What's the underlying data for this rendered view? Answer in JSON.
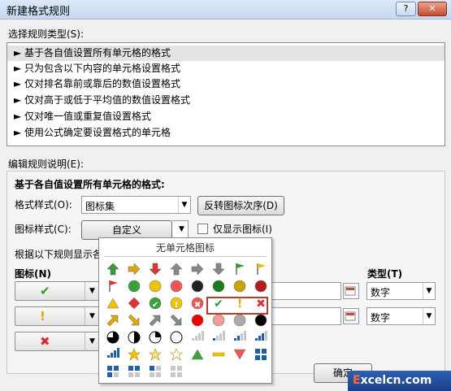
{
  "window": {
    "title": "新建格式规则",
    "help_label": "?",
    "close_label": "✕"
  },
  "rule_type": {
    "label": "选择规则类型(S):",
    "items": [
      "► 基于各自值设置所有单元格的格式",
      "► 只为包含以下内容的单元格设置格式",
      "► 仅对排名靠前或靠后的数值设置格式",
      "► 仅对高于或低于平均值的数值设置格式",
      "► 仅对唯一值或重复值设置格式",
      "► 使用公式确定要设置格式的单元格"
    ]
  },
  "edit": {
    "label": "编辑规则说明(E):",
    "heading": "基于各自值设置所有单元格的格式:",
    "format_style_label": "格式样式(O):",
    "format_style_value": "图标集",
    "reverse_button": "反转图标次序(D)",
    "icon_style_label": "图标样式(C):",
    "icon_style_value": "自定义",
    "show_icon_only_label": "仅显示图标(I)",
    "rules_intro": "根据以下规则显示各",
    "icon_col_label": "图标(N)",
    "type_col_label": "类型(T)",
    "rows": [
      {
        "icon": "green-check-icon",
        "glyph": "✔",
        "color": "#2e9b2e",
        "type": "数字"
      },
      {
        "icon": "yellow-exclamation-icon",
        "glyph": "!",
        "color": "#e0a800",
        "type": "数字"
      },
      {
        "icon": "red-cross-icon",
        "glyph": "✖",
        "color": "#d32f2f",
        "type": ""
      }
    ]
  },
  "popup": {
    "header": "无单元格图标"
  },
  "buttons": {
    "ok": "确定"
  },
  "watermark": {
    "prefix": "E",
    "text": "xcelcn.com"
  }
}
